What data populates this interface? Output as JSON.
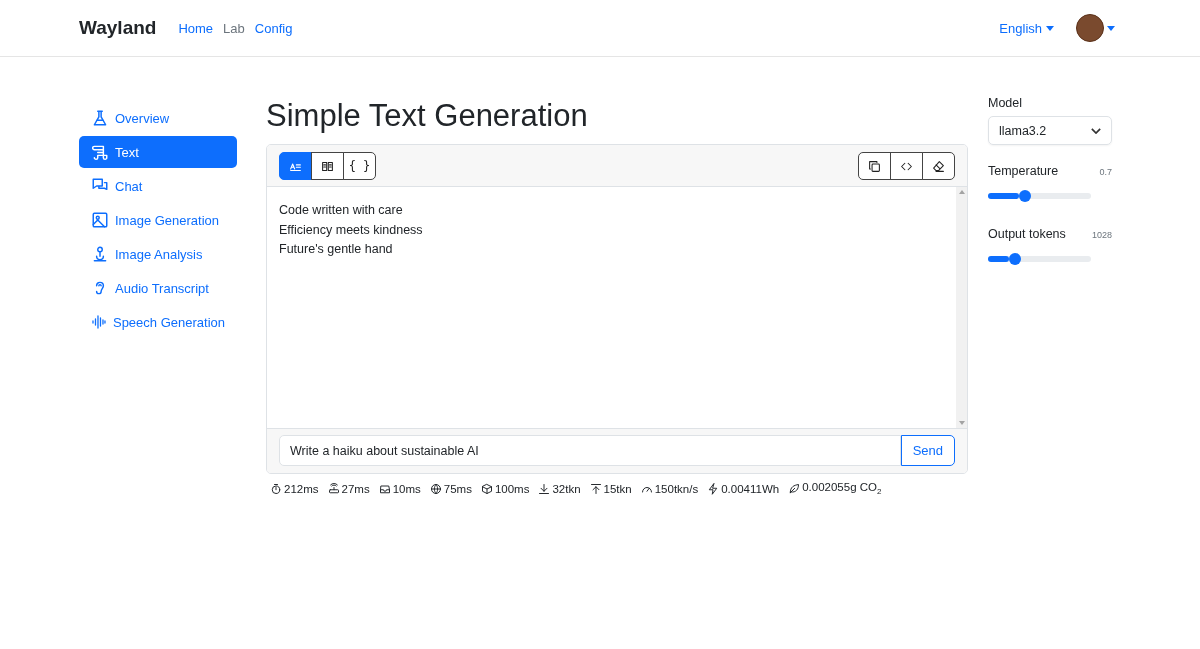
{
  "brand": "Wayland",
  "nav": [
    {
      "label": "Home",
      "selected": false
    },
    {
      "label": "Lab",
      "selected": true
    },
    {
      "label": "Config",
      "selected": false
    }
  ],
  "language": "English",
  "sidebar": {
    "items": [
      {
        "label": "Overview",
        "selected": false
      },
      {
        "label": "Text",
        "selected": true
      },
      {
        "label": "Chat",
        "selected": false
      },
      {
        "label": "Image Generation",
        "selected": false
      },
      {
        "label": "Image Analysis",
        "selected": false
      },
      {
        "label": "Audio Transcript",
        "selected": false
      },
      {
        "label": "Speech Generation",
        "selected": false
      }
    ]
  },
  "title": "Simple Text Generation",
  "view_buttons": [
    {
      "kind": "text",
      "selected": true
    },
    {
      "kind": "book",
      "selected": false
    },
    {
      "kind": "json",
      "label": "{ }",
      "selected": false
    }
  ],
  "action_buttons": [
    {
      "kind": "copy"
    },
    {
      "kind": "code"
    },
    {
      "kind": "eraser"
    }
  ],
  "output": [
    "Code written with care",
    "Efficiency meets kindness",
    "Future's gentle hand"
  ],
  "prompt": {
    "value": "Write a haiku about sustainable AI",
    "button": "Send"
  },
  "metrics": [
    {
      "kind": "timer",
      "value": "212ms"
    },
    {
      "kind": "router",
      "value": "27ms"
    },
    {
      "kind": "inbox",
      "value": "10ms"
    },
    {
      "kind": "globe",
      "value": "75ms"
    },
    {
      "kind": "box",
      "value": "100ms"
    },
    {
      "kind": "down",
      "value": "32tkn"
    },
    {
      "kind": "up",
      "value": "15tkn"
    },
    {
      "kind": "speed",
      "value": "150tkn/s"
    },
    {
      "kind": "bolt",
      "value": "0.00411Wh"
    },
    {
      "kind": "leaf",
      "value": "0.002055g CO$_{2}$"
    }
  ],
  "settings": {
    "model_label": "Model",
    "model": "llama3.2",
    "sliders": [
      {
        "label": "Temperature",
        "reading": "0.7",
        "level": 0.36
      },
      {
        "label": "Output tokens",
        "reading": "1028",
        "level": 0.26
      }
    ]
  }
}
